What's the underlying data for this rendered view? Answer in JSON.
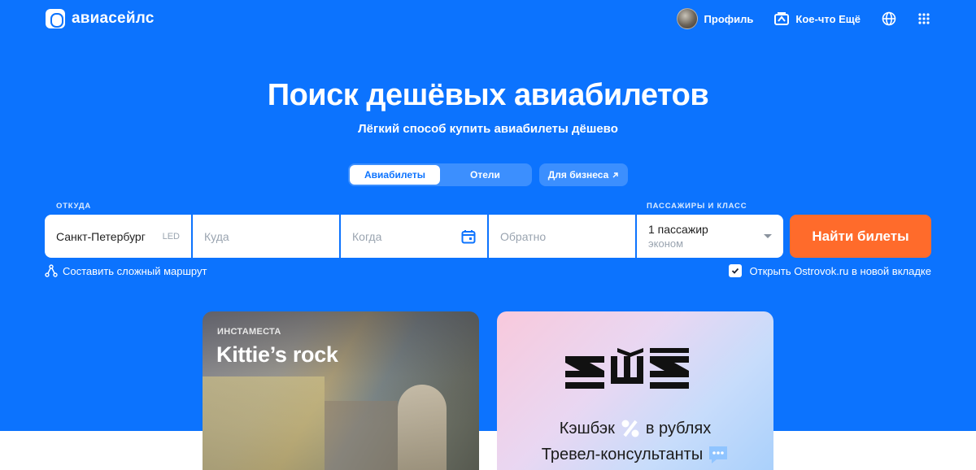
{
  "header": {
    "logo_text": "авиасейлс",
    "nav": {
      "profile_label": "Профиль",
      "more_label": "Кое-что Ещё"
    }
  },
  "hero": {
    "title": "Поиск дешёвых авиабилетов",
    "subtitle": "Лёгкий способ купить авиабилеты дёшево"
  },
  "tabs": [
    {
      "label": "Авиабилеты",
      "active": true
    },
    {
      "label": "Отели",
      "active": false
    }
  ],
  "business_link": "Для бизнеса",
  "search": {
    "from_label": "ОТКУДА",
    "passengers_label": "ПАССАЖИРЫ И КЛАСС",
    "from_value": "Санкт-Петербург",
    "from_code": "LED",
    "to_placeholder": "Куда",
    "when_placeholder": "Когда",
    "back_placeholder": "Обратно",
    "passengers_value": "1 пассажир",
    "class_value": "эконом",
    "submit_label": "Найти билеты"
  },
  "options": {
    "complex_route": "Составить сложный маршрут",
    "ostrovok": "Открыть Ostrovok.ru в новой вкладке",
    "ostrovok_checked": true
  },
  "cards": [
    {
      "tag": "ИНСТАМЕСТА",
      "title": "Kittie’s rock"
    },
    {
      "line1_before": "Кэшбэк",
      "line1_after": "в рублях",
      "line2": "Тревел-консультанты"
    }
  ],
  "colors": {
    "brand_blue": "#0c73fe",
    "cta_orange": "#ff6b2b"
  }
}
